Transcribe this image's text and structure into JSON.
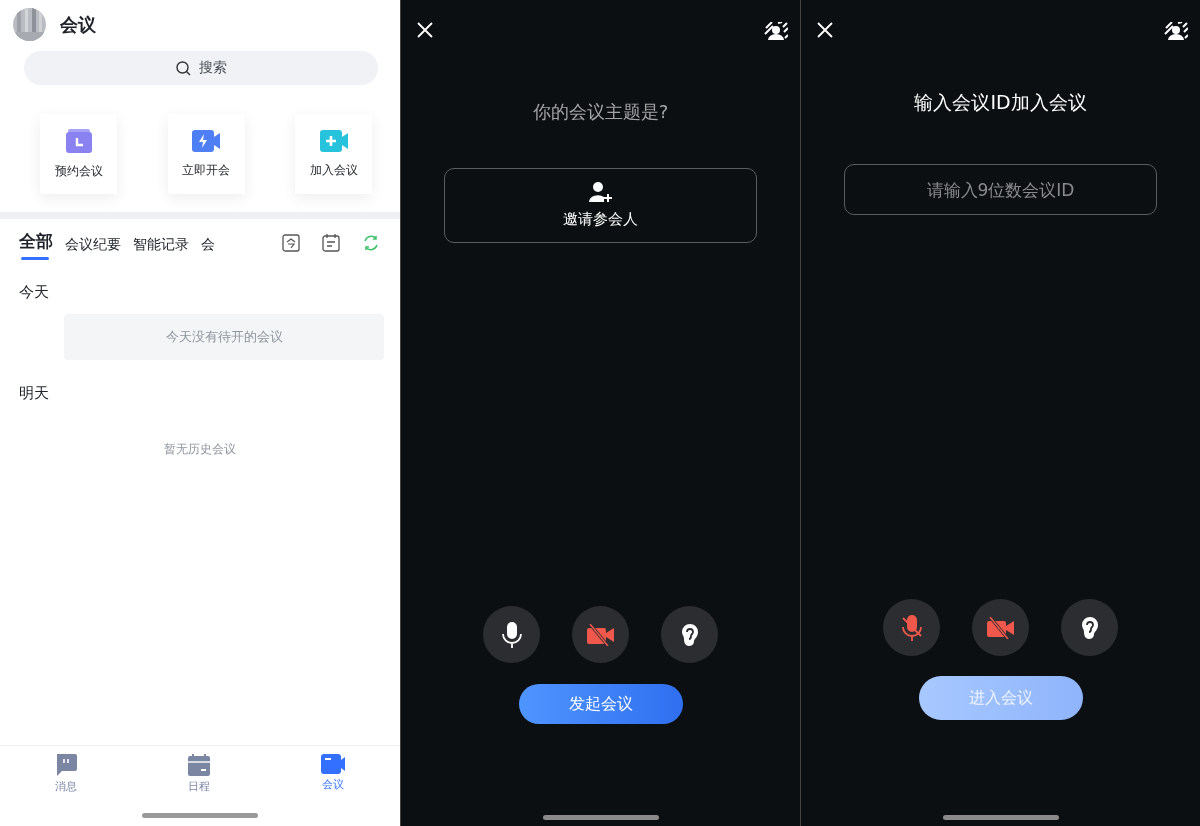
{
  "meetings_screen": {
    "title": "会议",
    "search": {
      "placeholder": "搜索"
    },
    "actions": [
      {
        "label": "预约会议",
        "kind": "schedule"
      },
      {
        "label": "立即开会",
        "kind": "instant"
      },
      {
        "label": "加入会议",
        "kind": "join"
      }
    ],
    "tabs": [
      {
        "label": "全部",
        "selected": true
      },
      {
        "label": "会议纪要",
        "selected": false
      },
      {
        "label": "智能记录",
        "selected": false
      },
      {
        "label": "会",
        "selected": false
      }
    ],
    "sections": [
      {
        "title": "今天",
        "empty_text": "今天没有待开的会议"
      },
      {
        "title": "明天"
      }
    ],
    "history_empty": "暂无历史会议",
    "nav": [
      {
        "label": "消息",
        "kind": "message",
        "selected": false
      },
      {
        "label": "日程",
        "kind": "calendar",
        "selected": false
      },
      {
        "label": "会议",
        "kind": "meeting",
        "selected": true
      }
    ]
  },
  "start_screen": {
    "topic_prompt": "你的会议主题是?",
    "invite_button": "邀请参会人",
    "controls": [
      {
        "kind": "mic",
        "muted": false
      },
      {
        "kind": "camera",
        "muted": true
      },
      {
        "kind": "ear",
        "muted": false
      }
    ],
    "start_button": {
      "label": "发起会议",
      "disabled": false
    }
  },
  "join_screen": {
    "title": "输入会议ID加入会议",
    "id_field": {
      "placeholder": "请输入9位数会议ID"
    },
    "controls": [
      {
        "kind": "mic",
        "muted": true
      },
      {
        "kind": "camera",
        "muted": true
      },
      {
        "kind": "ear",
        "muted": false
      }
    ],
    "join_button": {
      "label": "进入会议",
      "disabled": true
    }
  }
}
